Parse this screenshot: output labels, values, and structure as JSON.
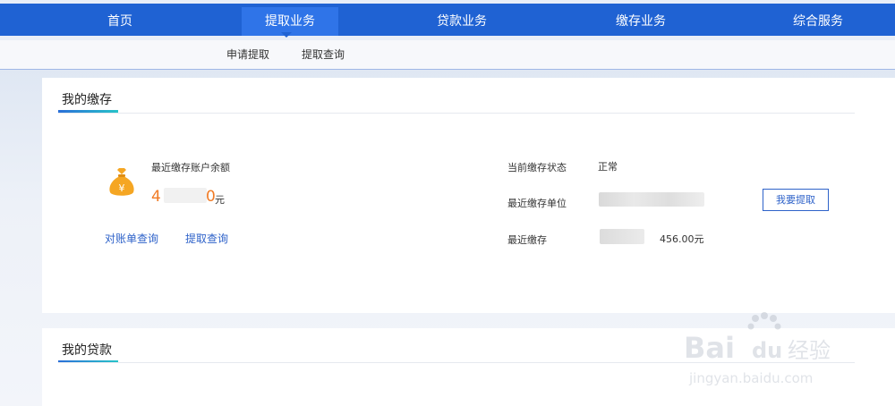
{
  "nav": {
    "items": [
      {
        "label": "首页"
      },
      {
        "label": "提取业务"
      },
      {
        "label": "贷款业务"
      },
      {
        "label": "缴存业务"
      },
      {
        "label": "综合服务"
      }
    ],
    "active_index": 1
  },
  "subnav": {
    "items": [
      {
        "label": "申请提取"
      },
      {
        "label": "提取查询"
      }
    ]
  },
  "deposit": {
    "title": "我的缴存",
    "balance_label": "最近缴存账户余额",
    "balance_prefix": "4",
    "balance_suffix": "0",
    "balance_unit": "元",
    "links": {
      "statement": "对账单查询",
      "withdraw_query": "提取查询"
    },
    "status_label": "当前缴存状态",
    "status_value": "正常",
    "unit_label": "最近缴存单位",
    "recent_label": "最近缴存",
    "recent_amount": "456.00元",
    "withdraw_button": "我要提取"
  },
  "loan": {
    "title": "我的贷款"
  },
  "watermark": {
    "brand": "Bai du 经验",
    "url": "jingyan.baidu.com"
  },
  "colors": {
    "nav_bg": "#1f62d3",
    "accent": "#2e62c9",
    "balance": "#f07b26",
    "bag": "#f5a623"
  }
}
